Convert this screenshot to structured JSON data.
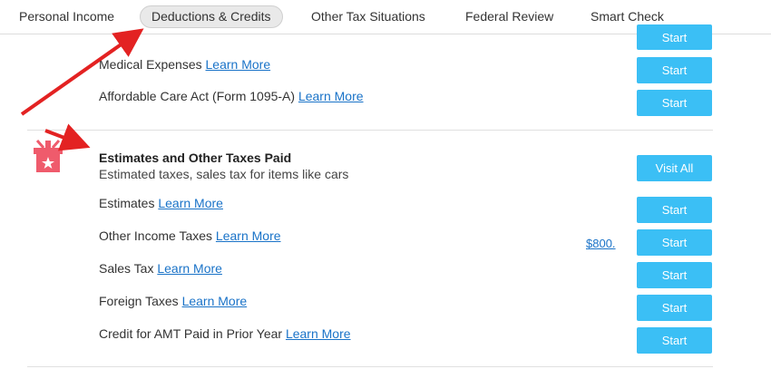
{
  "tabs": [
    {
      "label": "Personal Income"
    },
    {
      "label": "Deductions & Credits"
    },
    {
      "label": "Other Tax Situations"
    },
    {
      "label": "Federal Review"
    },
    {
      "label": "Smart Check"
    }
  ],
  "top_rows": [
    {
      "label": "Medical Expenses",
      "link": "Learn More",
      "button": "Start"
    },
    {
      "label": "Affordable Care Act (Form 1095-A)",
      "link": "Learn More",
      "button": "Start"
    }
  ],
  "cut_row": {
    "button": "Start"
  },
  "section": {
    "title": "Estimates and Other Taxes Paid",
    "subtitle": "Estimated taxes, sales tax for items like cars",
    "visit_all": "Visit All",
    "icon": "gift-box-icon",
    "rows": [
      {
        "label": "Estimates",
        "link": "Learn More",
        "button": "Start"
      },
      {
        "label": "Other Income Taxes",
        "link": "Learn More",
        "button": "Start",
        "amount": "$800."
      },
      {
        "label": "Sales Tax",
        "link": "Learn More",
        "button": "Start"
      },
      {
        "label": "Foreign Taxes",
        "link": "Learn More",
        "button": "Start"
      },
      {
        "label": "Credit for AMT Paid in Prior Year",
        "link": "Learn More",
        "button": "Start"
      }
    ]
  },
  "colors": {
    "button": "#3bbff5",
    "link": "#1a73c8",
    "arrow": "#e32222",
    "icon": "#ef5b6c"
  }
}
